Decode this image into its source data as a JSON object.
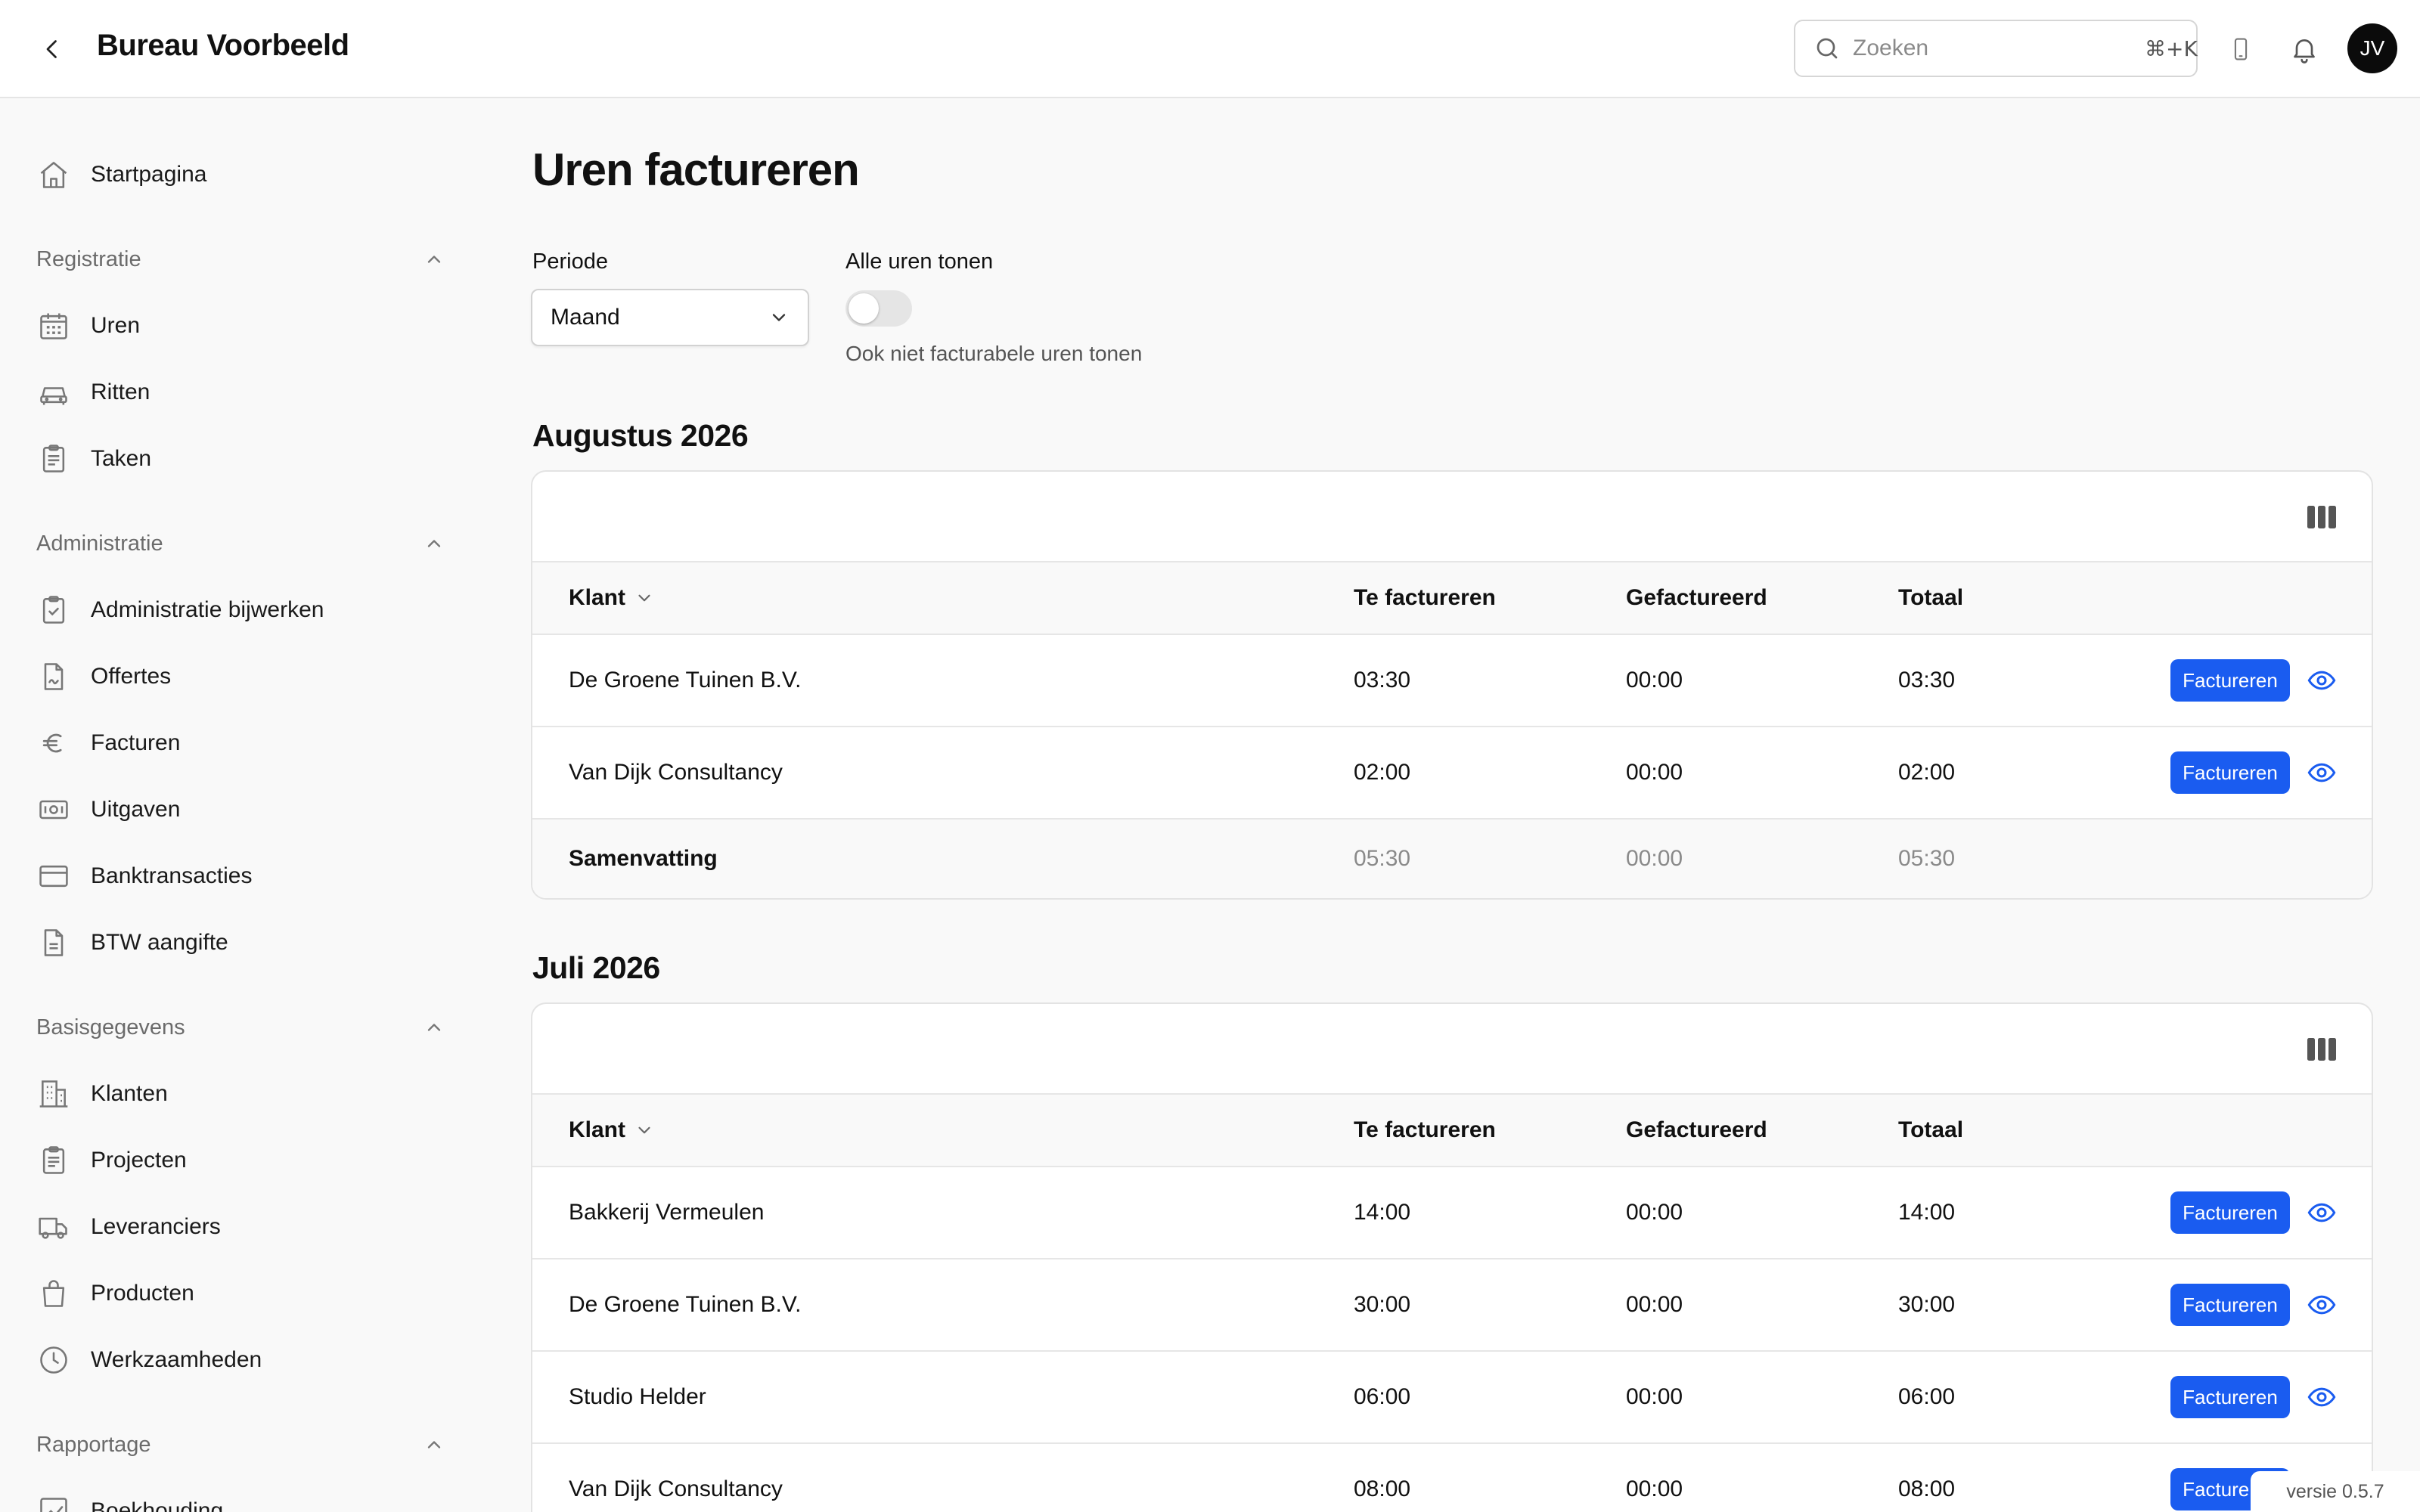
{
  "app": {
    "title": "Bureau Voorbeeld",
    "avatar_initials": "JV",
    "version": "versie 0.5.7"
  },
  "search": {
    "placeholder": "Zoeken",
    "shortcut": "⌘+K"
  },
  "sidebar": {
    "home": "Startpagina",
    "registratie": {
      "label": "Registratie",
      "items": [
        "Uren",
        "Ritten",
        "Taken"
      ]
    },
    "administratie": {
      "label": "Administratie",
      "items": [
        "Administratie bijwerken",
        "Offertes",
        "Facturen",
        "Uitgaven",
        "Banktransacties",
        "BTW aangifte"
      ]
    },
    "basisgegevens": {
      "label": "Basisgegevens",
      "items": [
        "Klanten",
        "Projecten",
        "Leveranciers",
        "Producten",
        "Werkzaamheden"
      ]
    },
    "rapportage": {
      "label": "Rapportage",
      "items": [
        "Boekhouding"
      ]
    }
  },
  "page": {
    "title": "Uren factureren",
    "periode_label": "Periode",
    "periode_value": "Maand",
    "alle_uren_label": "Alle uren tonen",
    "alle_uren_help": "Ook niet facturabele uren tonen"
  },
  "table_columns": {
    "klant": "Klant",
    "te_factureren": "Te factureren",
    "gefactureerd": "Gefactureerd",
    "totaal": "Totaal"
  },
  "actions": {
    "factureren": "Factureren"
  },
  "groups": [
    {
      "title": "Augustus 2026",
      "rows": [
        {
          "klant": "De Groene Tuinen B.V.",
          "te_factureren": "03:30",
          "gefactureerd": "00:00",
          "totaal": "03:30"
        },
        {
          "klant": "Van Dijk Consultancy",
          "te_factureren": "02:00",
          "gefactureerd": "00:00",
          "totaal": "02:00"
        }
      ],
      "summary": {
        "label": "Samenvatting",
        "te_factureren": "05:30",
        "gefactureerd": "00:00",
        "totaal": "05:30"
      }
    },
    {
      "title": "Juli 2026",
      "rows": [
        {
          "klant": "Bakkerij Vermeulen",
          "te_factureren": "14:00",
          "gefactureerd": "00:00",
          "totaal": "14:00"
        },
        {
          "klant": "De Groene Tuinen B.V.",
          "te_factureren": "30:00",
          "gefactureerd": "00:00",
          "totaal": "30:00"
        },
        {
          "klant": "Studio Helder",
          "te_factureren": "06:00",
          "gefactureerd": "00:00",
          "totaal": "06:00"
        },
        {
          "klant": "Van Dijk Consultancy",
          "te_factureren": "08:00",
          "gefactureerd": "00:00",
          "totaal": "08:00"
        }
      ]
    }
  ],
  "colors": {
    "primary": "#1a5cf0",
    "background": "#f9f9f9",
    "toggle_off": "#e5e5e5"
  }
}
